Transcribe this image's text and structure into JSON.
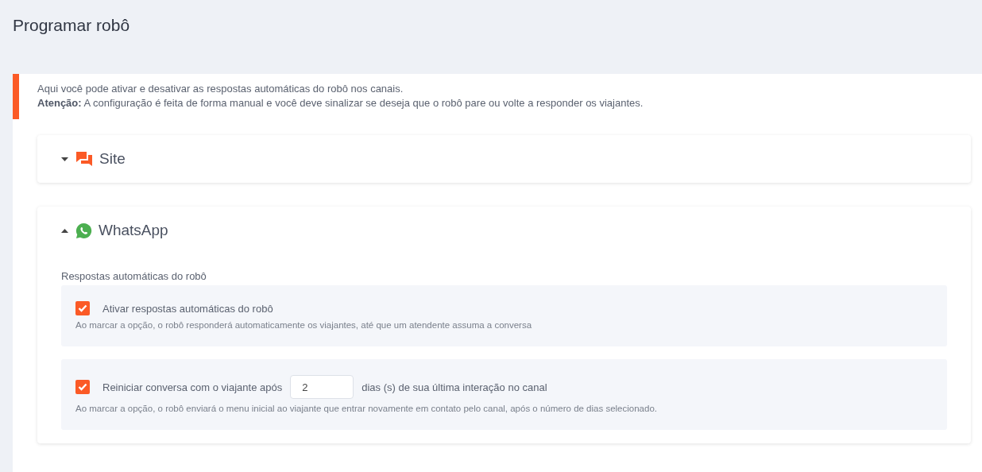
{
  "page": {
    "title": "Programar robô"
  },
  "notice": {
    "lines": [
      "Aqui você pode ativar e desativar as respostas automáticas do robô nos canais.",
      "**Atenção:** A configuração é feita de forma manual e você deve sinalizar se deseja que o robô pare ou volte a responder os viajantes."
    ]
  },
  "channels": [
    {
      "name": "Site",
      "kind": "chat",
      "expanded": false
    },
    {
      "name": "WhatsApp",
      "kind": "whatsapp",
      "expanded": true,
      "section_label": "Respostas automáticas do robô",
      "options": [
        {
          "kind": "checkbox",
          "checked": true,
          "label": "Ativar respostas automáticas do robô",
          "hint": "Ao marcar a opção, o robô responderá automaticamente os viajantes, até que um atendente assuma a conversa"
        },
        {
          "kind": "checkbox-days",
          "checked": true,
          "label": "Reiniciar conversa com o viajante após",
          "value": "2",
          "suffix": "dias (s) de sua última interação no canal",
          "hint": "Ao marcar a opção, o robô enviará o menu inicial ao viajante que entrar novamente em contato pelo canal, após o número de dias selecionado."
        }
      ]
    }
  ]
}
